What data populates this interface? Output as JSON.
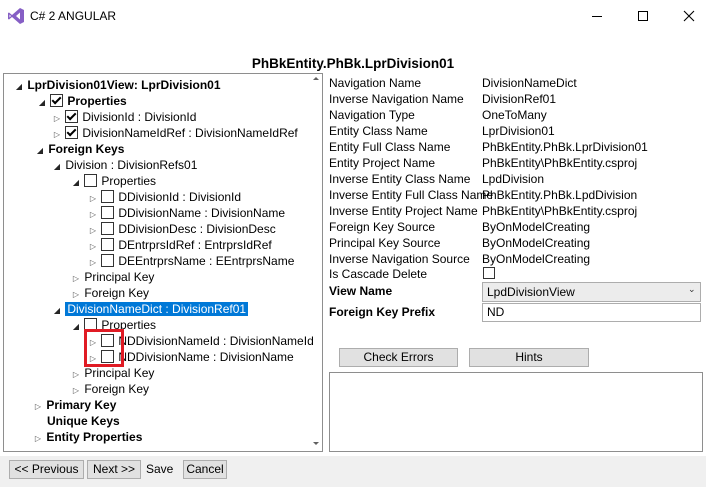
{
  "window": {
    "title": "C# 2 ANGULAR",
    "accent": "#0078d7",
    "highlight_color": "#e01b24"
  },
  "page": {
    "title": "PhBkEntity.PhBk.LprDivision01"
  },
  "tree": {
    "root": "LprDivision01View: LprDivision01",
    "properties": "Properties",
    "division_id": "DivisionId : DivisionId",
    "division_name_id_ref": "DivisionNameIdRef : DivisionNameIdRef",
    "foreign_keys": "Foreign Keys",
    "division_refs": "Division : DivisionRefs01",
    "fk1_properties": "Properties",
    "ddivision_id": "DDivisionId : DivisionId",
    "ddivision_name": "DDivisionName : DivisionName",
    "ddivision_desc": "DDivisionDesc : DivisionDesc",
    "dentrprs_id_ref": "DEntrprsIdRef : EntrprsIdRef",
    "deentrprs_name": "DEEntrprsName : EEntrprsName",
    "fk1_principal_key": "Principal Key",
    "fk1_foreign_key": "Foreign Key",
    "division_name_dict": "DivisionNameDict : DivisionRef01",
    "fk2_properties": "Properties",
    "nd_division_name_id": "NDDivisionNameId : DivisionNameId",
    "nd_division_name": "NDDivisionName : DivisionName",
    "fk2_principal_key": "Principal Key",
    "fk2_foreign_key": "Foreign Key",
    "primary_key": "Primary Key",
    "unique_keys": "Unique Keys",
    "entity_properties": "Entity Properties"
  },
  "props": [
    {
      "label": "Navigation Name",
      "value": "DivisionNameDict"
    },
    {
      "label": "Inverse Navigation Name",
      "value": "DivisionRef01"
    },
    {
      "label": "Navigation Type",
      "value": "OneToMany"
    },
    {
      "label": "Entity Class Name",
      "value": "LprDivision01"
    },
    {
      "label": "Entity Full Class Name",
      "value": "PhBkEntity.PhBk.LprDivision01"
    },
    {
      "label": "Entity Project Name",
      "value": "PhBkEntity\\PhBkEntity.csproj"
    },
    {
      "label": "Inverse Entity Class Name",
      "value": "LpdDivision"
    },
    {
      "label": "Inverse Entity Full Class Name",
      "value": "PhBkEntity.PhBk.LpdDivision"
    },
    {
      "label": "Inverse Entity Project Name",
      "value": "PhBkEntity\\PhBkEntity.csproj"
    },
    {
      "label": "Foreign Key Source",
      "value": "ByOnModelCreating"
    },
    {
      "label": "Principal Key Source",
      "value": "ByOnModelCreating"
    },
    {
      "label": "Inverse Navigation Source",
      "value": "ByOnModelCreating"
    }
  ],
  "cascade_delete_label": "Is Cascade Delete",
  "view_name": {
    "label": "View Name",
    "value": "LpdDivisionView"
  },
  "fk_prefix": {
    "label": "Foreign Key Prefix",
    "value": "ND"
  },
  "buttons": {
    "check_errors": "Check Errors",
    "hints": "Hints",
    "previous": "<< Previous",
    "next": "Next >>",
    "save": "Save",
    "cancel": "Cancel"
  }
}
